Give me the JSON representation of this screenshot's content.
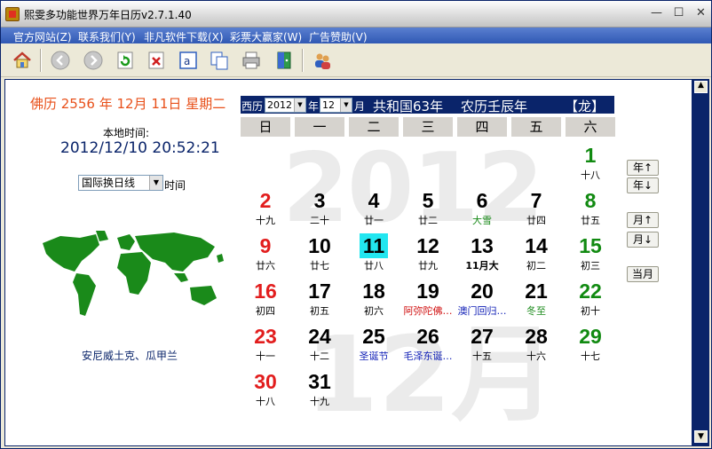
{
  "window": {
    "title": "熙雯多功能世界万年日历v2.7.1.40",
    "min_glyph": "—",
    "max_glyph": "☐",
    "close_glyph": "✕"
  },
  "menu": [
    "官方网站(Z)",
    "联系我们(Y)",
    "非凡软件下载(X)",
    "彩票大赢家(W)",
    "广告赞助(V)"
  ],
  "toolbar": {
    "icons": [
      "home-icon",
      "back-icon",
      "forward-icon",
      "refresh-icon",
      "delete-icon",
      "text-icon",
      "copy-icon",
      "print-icon",
      "exit-icon",
      "users-icon"
    ]
  },
  "left": {
    "buddhist": "佛历 2556 年 12月 11日 星期二",
    "local_label": "本地时间:",
    "local_time": "2012/12/10 20:52:21",
    "tz_value": "国际换日线",
    "tz_suffix": "时间",
    "place": "安尼威土克、瓜甲兰"
  },
  "calendar": {
    "h_xili": "西历",
    "year_value": "2012",
    "h_nian": "年",
    "month_value": "12",
    "h_yue": "月",
    "republic": "共和国63年",
    "lunar_year": "农历壬辰年",
    "zodiac": "【龙】",
    "weekdays": [
      "日",
      "一",
      "二",
      "三",
      "四",
      "五",
      "六"
    ],
    "watermark_year": "2012",
    "watermark_month": "12月",
    "weeks": [
      [
        null,
        null,
        null,
        null,
        null,
        null,
        {
          "day": "1",
          "lunar": "十八"
        }
      ],
      [
        {
          "day": "2",
          "lunar": "十九"
        },
        {
          "day": "3",
          "lunar": "二十"
        },
        {
          "day": "4",
          "lunar": "廿一"
        },
        {
          "day": "5",
          "lunar": "廿二"
        },
        {
          "day": "6",
          "lunar": "大雪",
          "kind": "term"
        },
        {
          "day": "7",
          "lunar": "廿四"
        },
        {
          "day": "8",
          "lunar": "廿五"
        }
      ],
      [
        {
          "day": "9",
          "lunar": "廿六"
        },
        {
          "day": "10",
          "lunar": "廿七"
        },
        {
          "day": "11",
          "lunar": "廿八",
          "today": true
        },
        {
          "day": "12",
          "lunar": "廿九"
        },
        {
          "day": "13",
          "lunar": "11月大",
          "kind": "bold"
        },
        {
          "day": "14",
          "lunar": "初二"
        },
        {
          "day": "15",
          "lunar": "初三"
        }
      ],
      [
        {
          "day": "16",
          "lunar": "初四"
        },
        {
          "day": "17",
          "lunar": "初五"
        },
        {
          "day": "18",
          "lunar": "初六"
        },
        {
          "day": "19",
          "lunar": "阿弥陀佛…",
          "kind": "rel"
        },
        {
          "day": "20",
          "lunar": "澳门回归…",
          "kind": "fest"
        },
        {
          "day": "21",
          "lunar": "冬至",
          "kind": "term"
        },
        {
          "day": "22",
          "lunar": "初十"
        }
      ],
      [
        {
          "day": "23",
          "lunar": "十一"
        },
        {
          "day": "24",
          "lunar": "十二"
        },
        {
          "day": "25",
          "lunar": "圣诞节",
          "kind": "fest"
        },
        {
          "day": "26",
          "lunar": "毛泽东诞…",
          "kind": "fest"
        },
        {
          "day": "27",
          "lunar": "十五"
        },
        {
          "day": "28",
          "lunar": "十六"
        },
        {
          "day": "29",
          "lunar": "十七"
        }
      ],
      [
        {
          "day": "30",
          "lunar": "十八"
        },
        {
          "day": "31",
          "lunar": "十九"
        },
        null,
        null,
        null,
        null,
        null
      ]
    ]
  },
  "side_buttons": {
    "year_up": "年↑",
    "year_down": "年↓",
    "month_up": "月↑",
    "month_down": "月↓",
    "this_month": "当月"
  },
  "scrollbar": {
    "up_glyph": "▲",
    "down_glyph": "▼"
  },
  "colors": {
    "accent": "#0a246a",
    "sunday": "#e21d1d",
    "saturday": "#118a11",
    "today_bg": "#22e6f0",
    "buddhist_text": "#e8501a"
  }
}
